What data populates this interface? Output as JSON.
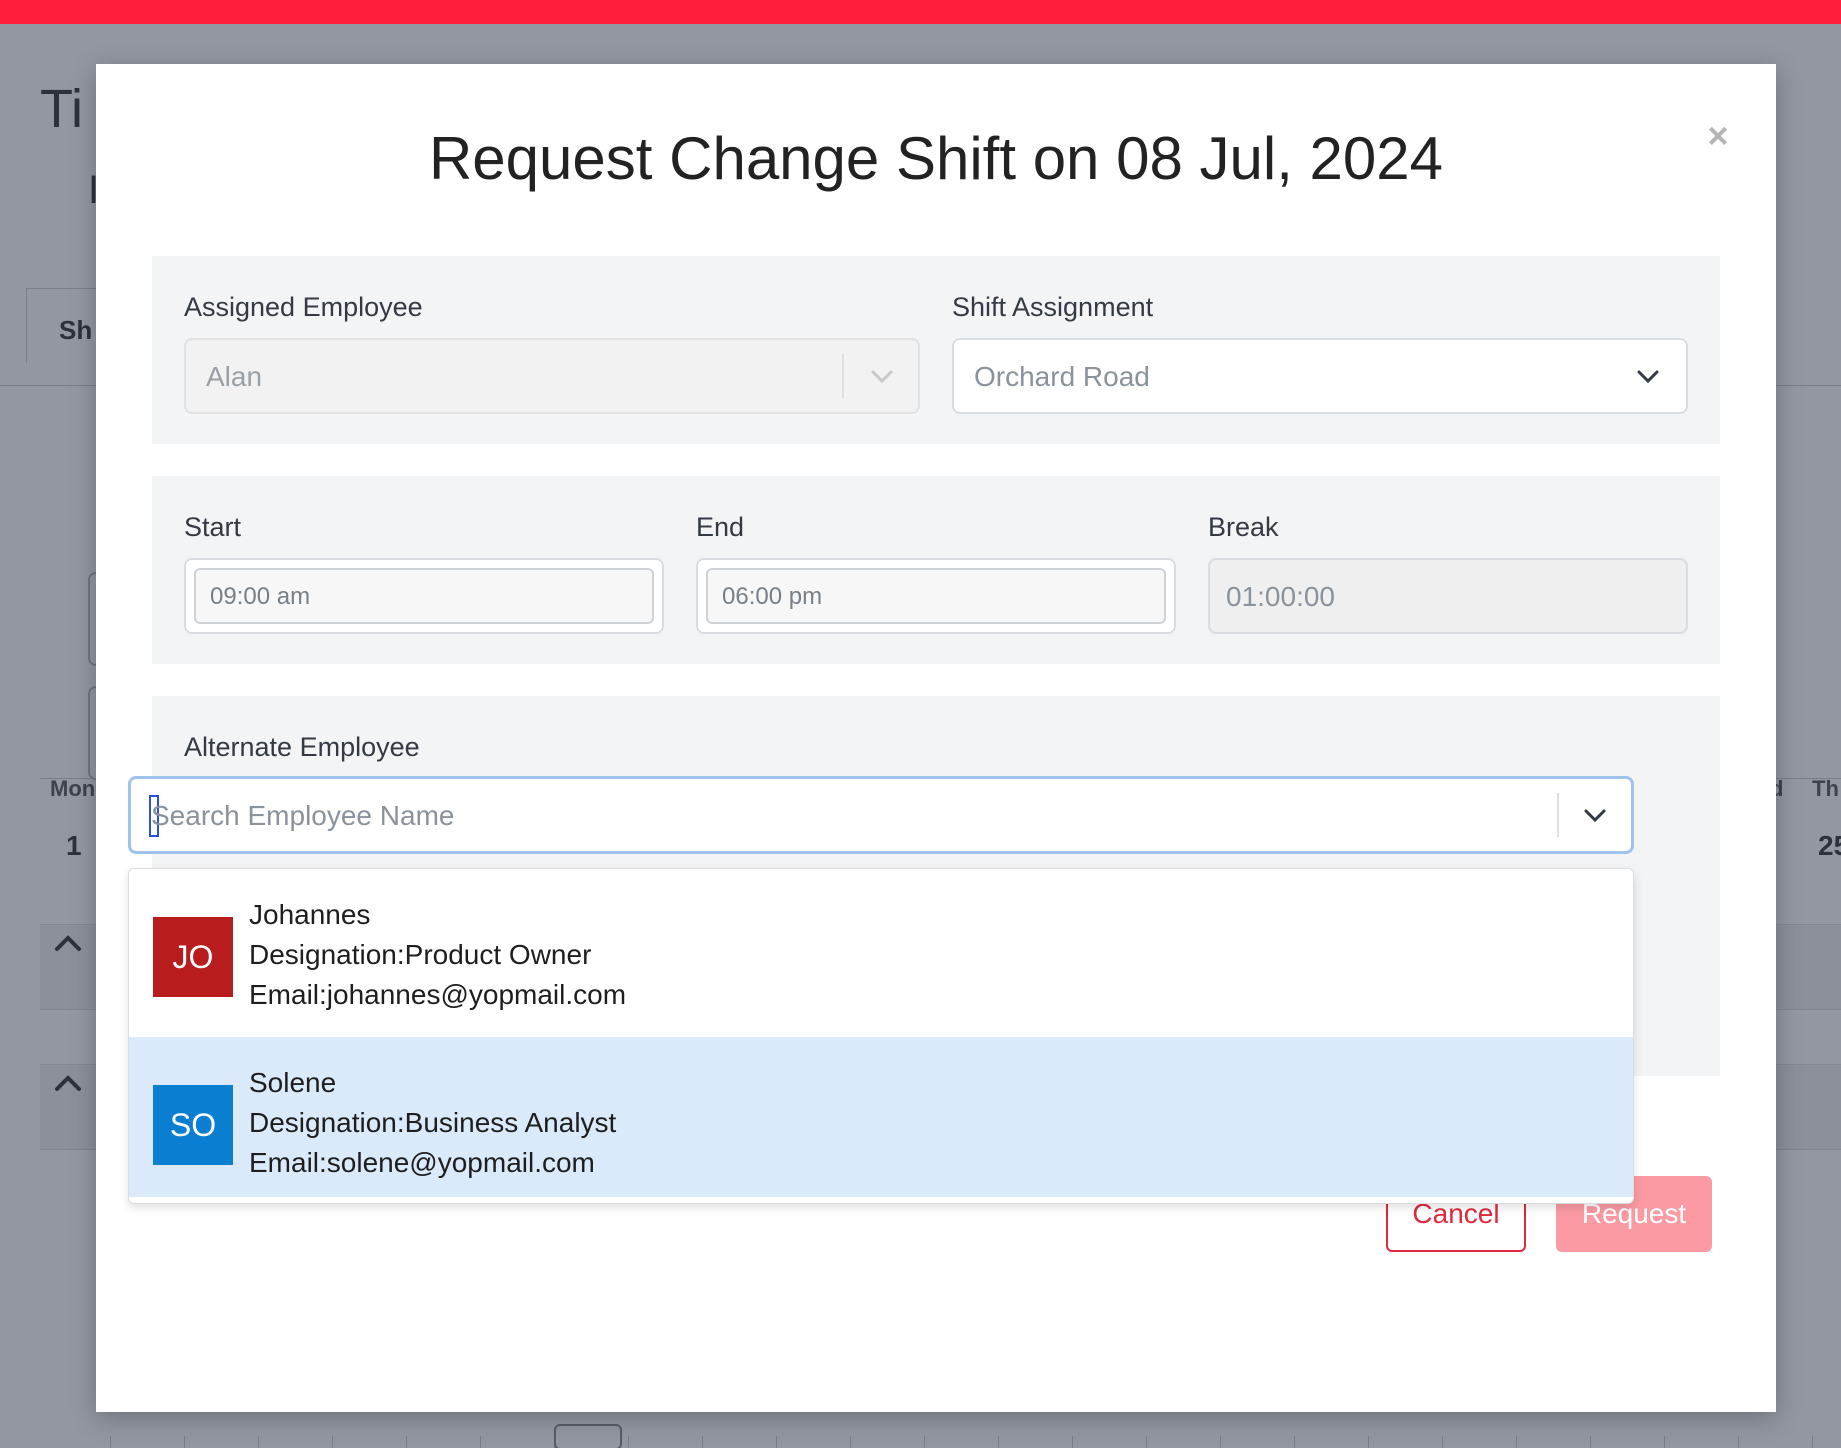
{
  "background": {
    "title_partial": "Ti",
    "subtitle_partial": "I",
    "tab_partial": "Sh",
    "day_partial": "Mon",
    "day_number": "1",
    "right_day_partial": "d",
    "right_day2_partial": "Th",
    "right_number_partial": "25",
    "accent_color": "#ff1f3b"
  },
  "modal": {
    "title": "Request Change Shift on 08 Jul, 2024",
    "close_label": "×",
    "assigned_employee": {
      "label": "Assigned Employee",
      "value": "Alan"
    },
    "shift_assignment": {
      "label": "Shift Assignment",
      "value": "Orchard Road"
    },
    "start": {
      "label": "Start",
      "value": "09:00 am"
    },
    "end": {
      "label": "End",
      "value": "06:00 pm"
    },
    "break": {
      "label": "Break",
      "value": "01:00:00"
    },
    "alternate_employee": {
      "label": "Alternate Employee",
      "placeholder": "Search Employee Name",
      "options": [
        {
          "initials": "JO",
          "name": "Johannes",
          "designation": "Designation:Product Owner",
          "email": "Email:johannes@yopmail.com",
          "color": "#b91c1c"
        },
        {
          "initials": "SO",
          "name": "Solene",
          "designation": "Designation:Business Analyst",
          "email": "Email:solene@yopmail.com",
          "color": "#0a7fd1"
        }
      ]
    },
    "buttons": {
      "cancel": "Cancel",
      "request": "Request"
    }
  }
}
